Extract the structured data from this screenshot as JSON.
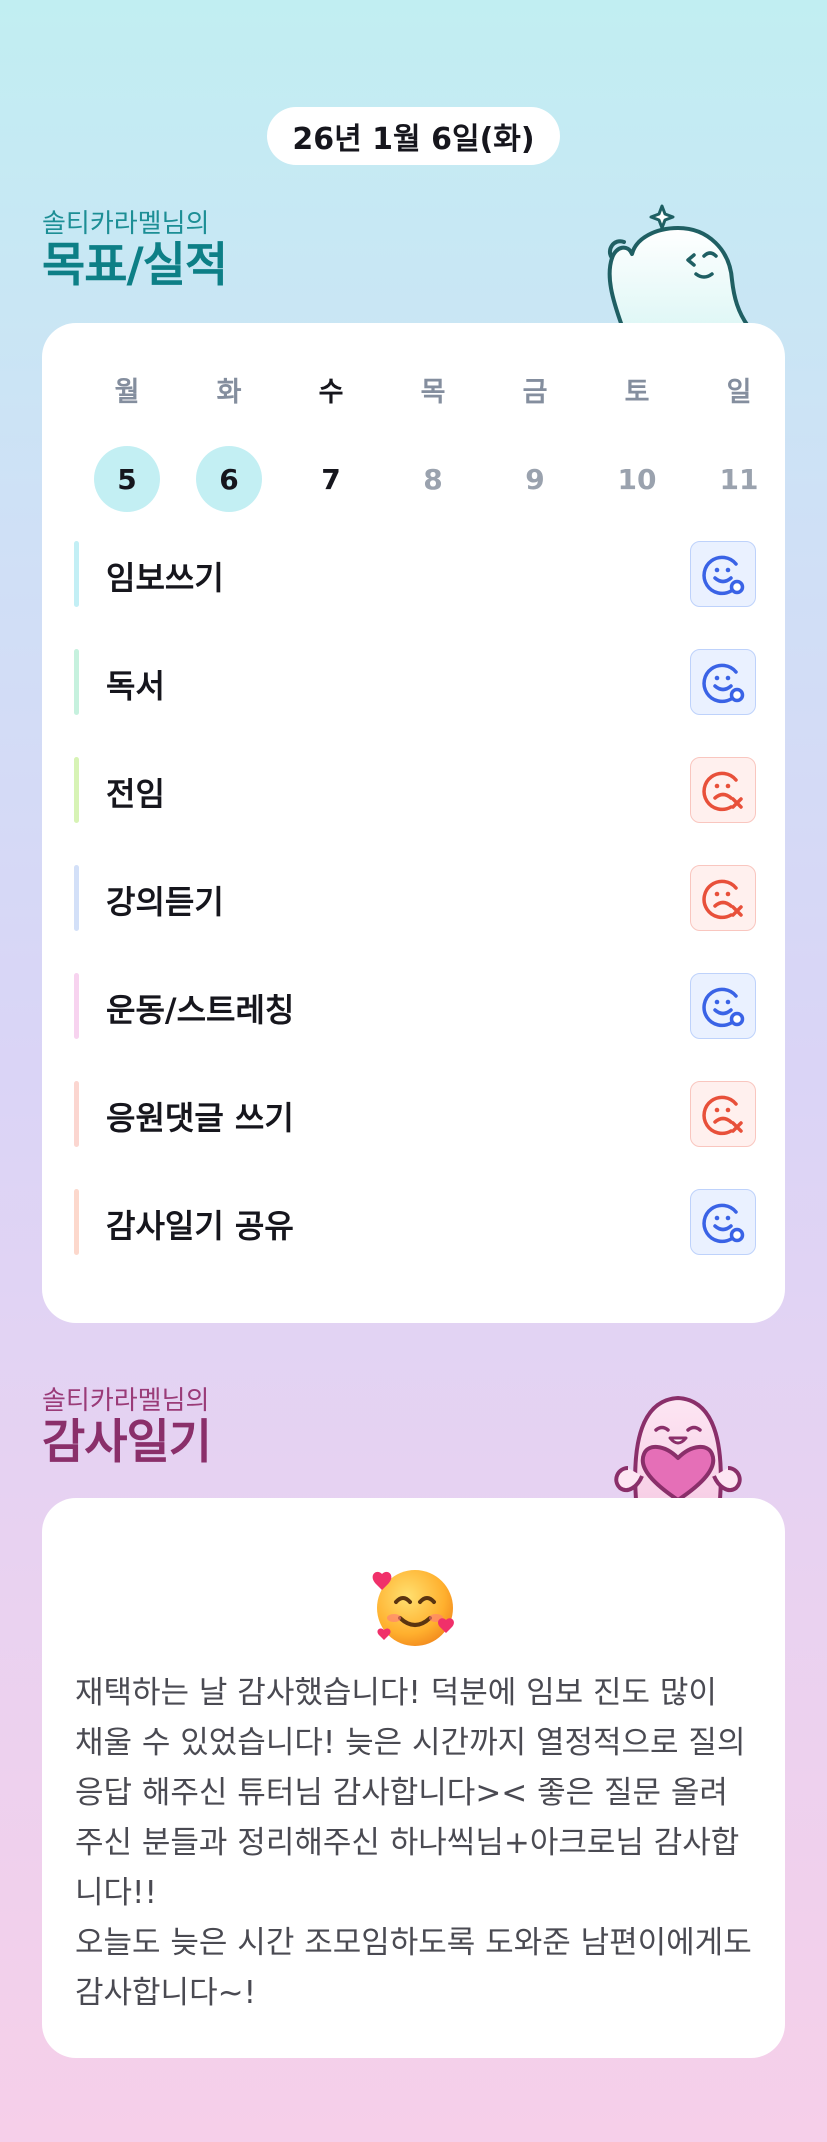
{
  "header": {
    "date": "26년 1월 6일(화)"
  },
  "goals_section": {
    "subtitle": "솔티카라멜님의",
    "title": "목표/실적"
  },
  "week": {
    "days": [
      {
        "name": "월",
        "num": "5",
        "status": "done"
      },
      {
        "name": "화",
        "num": "6",
        "status": "done"
      },
      {
        "name": "수",
        "num": "7",
        "status": "today"
      },
      {
        "name": "목",
        "num": "8",
        "status": "future"
      },
      {
        "name": "금",
        "num": "9",
        "status": "future"
      },
      {
        "name": "토",
        "num": "10",
        "status": "future"
      },
      {
        "name": "일",
        "num": "11",
        "status": "future"
      }
    ]
  },
  "goals": [
    {
      "label": "임보쓰기",
      "color": "#c3eff5",
      "result": "success",
      "icon": "smile-check-icon"
    },
    {
      "label": "독서",
      "color": "#c6f1de",
      "result": "success",
      "icon": "smile-check-icon"
    },
    {
      "label": "전임",
      "color": "#d7f3b5",
      "result": "fail",
      "icon": "sad-x-icon"
    },
    {
      "label": "강의듣기",
      "color": "#d3e0f8",
      "result": "fail",
      "icon": "sad-x-icon"
    },
    {
      "label": "운동/스트레칭",
      "color": "#f7d3ef",
      "result": "success",
      "icon": "smile-check-icon"
    },
    {
      "label": "응원댓글 쓰기",
      "color": "#fbd6d0",
      "result": "fail",
      "icon": "sad-x-icon"
    },
    {
      "label": "감사일기 공유",
      "color": "#fcd8cc",
      "result": "success",
      "icon": "smile-check-icon"
    }
  ],
  "gratitude_section": {
    "subtitle": "솔티카라멜님의",
    "title": "감사일기"
  },
  "gratitude": {
    "emoji": "smiling-face-with-hearts-icon",
    "text": "재택하는 날 감사했습니다! 덕분에 임보 진도 많이 채울 수 있었습니다! 늦은 시간까지 열정적으로 질의응답 해주신 튜터님 감사합니다>< 좋은 질문 올려주신 분들과 정리해주신 하나씩님+아크로님 감사합니다!!\n오늘도 늦은 시간 조모임하도록 도와준 남편이에게도 감사합니다~!"
  },
  "colors": {
    "success": "#3a63e6",
    "fail": "#e8503a",
    "accent_teal": "#0d7f86",
    "accent_plum": "#8a2f6a"
  }
}
